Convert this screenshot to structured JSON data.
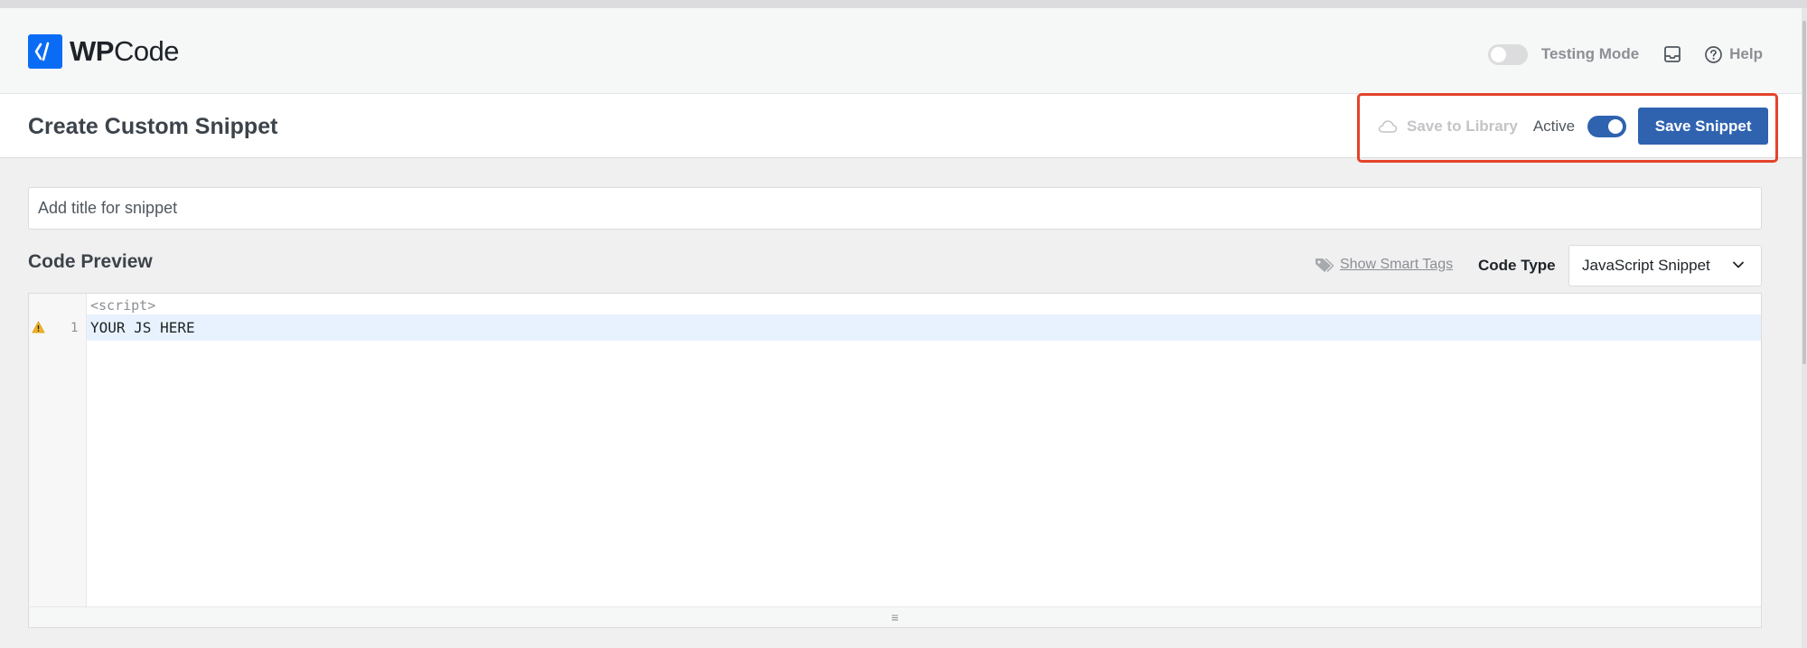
{
  "app": {
    "brand_bold": "WP",
    "brand_regular": "Code"
  },
  "header": {
    "testing_mode_label": "Testing Mode",
    "testing_mode_enabled": false,
    "help_label": "Help"
  },
  "page": {
    "title": "Create Custom Snippet"
  },
  "actions": {
    "save_library_label": "Save to Library",
    "active_label": "Active",
    "active_enabled": true,
    "save_snippet_label": "Save Snippet"
  },
  "snippet": {
    "title_placeholder": "Add title for snippet"
  },
  "code_preview": {
    "label": "Code Preview",
    "smart_tags_label": "Show Smart Tags",
    "code_type_label": "Code Type",
    "code_type_value": "JavaScript Snippet"
  },
  "editor": {
    "open_tag": "<script>",
    "lines": [
      {
        "number": "1",
        "text": "YOUR JS HERE"
      }
    ],
    "resize_handle": "≡"
  },
  "colors": {
    "brand_blue": "#0a6cf5",
    "button_blue": "#2f63b0",
    "highlight_red": "#e4432a",
    "line_highlight": "#e8f2fe"
  },
  "icons": {
    "logo": "wpcode-logo-icon",
    "inbox": "inbox-icon",
    "help": "help-circle-icon",
    "cloud": "cloud-icon",
    "tag": "tag-icon",
    "chevron": "chevron-down-icon",
    "warning": "warning-icon"
  }
}
